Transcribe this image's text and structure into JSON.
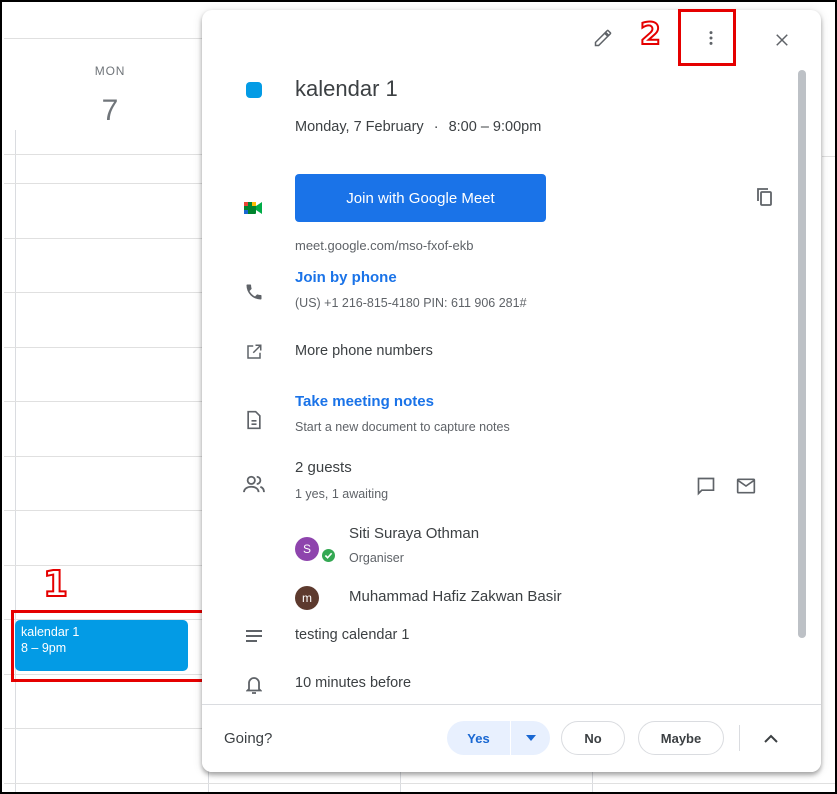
{
  "calendar": {
    "day_name": "MON",
    "day_number": "7",
    "event_chip": {
      "title": "kalendar 1",
      "time": "8 – 9pm",
      "color": "#039be5"
    }
  },
  "annotations": {
    "label_1": "1",
    "label_2": "2",
    "color": "#e50000"
  },
  "popup": {
    "event_title": "kalendar 1",
    "event_color": "#039be5",
    "date": "Monday, 7 February",
    "time_separator": "·",
    "time": "8:00 – 9:00pm",
    "meet": {
      "button_label": "Join with Google Meet",
      "url": "meet.google.com/mso-fxof-ekb"
    },
    "phone": {
      "label": "Join by phone",
      "details": "(US) +1 216-815-4180 PIN: 611 906 281#"
    },
    "more_numbers": "More phone numbers",
    "notes": {
      "label": "Take meeting notes",
      "sub": "Start a new document to capture notes"
    },
    "guests": {
      "count_label": "2 guests",
      "summary": "1 yes, 1 awaiting",
      "list": [
        {
          "initial": "S",
          "name": "Siti Suraya Othman",
          "role": "Organiser",
          "color": "#8e44ad"
        },
        {
          "initial": "m",
          "name": "Muhammad Hafiz Zakwan Basir",
          "role": "",
          "color": "#5d3a2e"
        }
      ]
    },
    "description": "testing calendar 1",
    "reminder": "10 minutes before",
    "footer": {
      "going_label": "Going?",
      "yes": "Yes",
      "no": "No",
      "maybe": "Maybe"
    },
    "accent": "#1a73e8"
  }
}
